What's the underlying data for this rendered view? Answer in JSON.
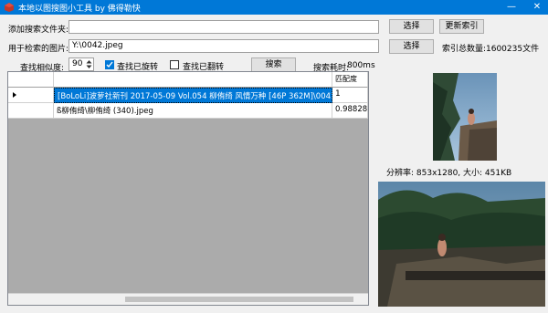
{
  "window": {
    "title": "本地以图搜图小工具 by 佛得勒快",
    "minimize_label": "—",
    "close_label": "✕"
  },
  "form": {
    "add_folder_label": "添加搜索文件夹:",
    "add_folder_value": "",
    "query_image_label": "用于检索的图片:",
    "query_image_value": "Y:\\0042.jpeg",
    "similarity_label": "查找相似度:",
    "similarity_value": "90",
    "find_rotated_label": "查找已旋转",
    "find_rotated_checked": true,
    "find_flipped_label": "查找已翻转",
    "find_flipped_checked": false,
    "search_button": "搜索",
    "search_time_label": "搜索耗时:",
    "search_time_value": "800ms"
  },
  "right_panel": {
    "select_button_1": "选择",
    "update_index_button": "更新索引",
    "select_button_2": "选择",
    "index_count_label": "索引总数量:",
    "index_count_value": "1600235文件",
    "resolution_text": "分辨率: 853x1280, 大小: 451KB"
  },
  "results": {
    "columns": [
      "",
      "",
      "匹配度"
    ],
    "rows": [
      {
        "path": "[BoLoLi]波萝社新刊 2017-05-09 Vol.054 柳侑绮 风情万种 [46P 362M]\\0042.jpeg",
        "score": "1",
        "selected": true
      },
      {
        "path": "ß柳侑绮\\柳侑绮 (340).jpeg",
        "score": "0.98828125",
        "selected": false
      }
    ]
  },
  "colors": {
    "titlebar": "#0078d7",
    "selection": "#0078d7",
    "grid_background": "#ababab"
  }
}
